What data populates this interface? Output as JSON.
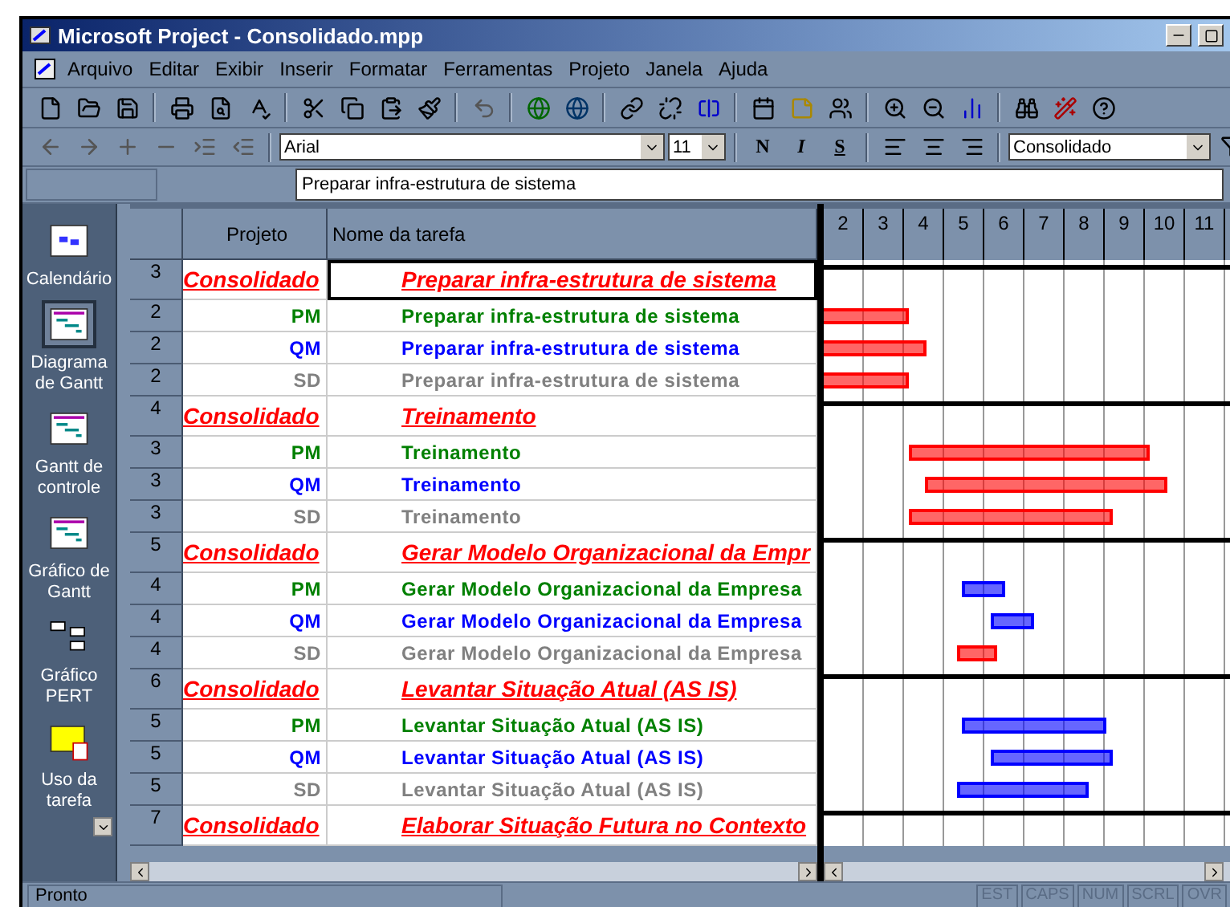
{
  "window": {
    "title": "Microsoft Project - Consolidado.mpp"
  },
  "menu": [
    "Arquivo",
    "Editar",
    "Exibir",
    "Inserir",
    "Formatar",
    "Ferramentas",
    "Projeto",
    "Janela",
    "Ajuda"
  ],
  "format_bar": {
    "font": "Arial",
    "size": "11",
    "bold": "N",
    "italic": "I",
    "underline": "S",
    "filter": "Consolidado"
  },
  "entry_bar": {
    "value": "Preparar infra-estrutura de sistema"
  },
  "view_bar": [
    {
      "label": "Calendário",
      "selected": false
    },
    {
      "label": "Diagrama de Gantt",
      "selected": true
    },
    {
      "label": "Gantt de controle",
      "selected": false
    },
    {
      "label": "Gráfico de Gantt",
      "selected": false
    },
    {
      "label": "Gráfico PERT",
      "selected": false
    },
    {
      "label": "Uso da tarefa",
      "selected": false
    }
  ],
  "table": {
    "columns": [
      "Projeto",
      "Nome da tarefa"
    ],
    "rows": [
      {
        "kind": "summary",
        "id": "3",
        "project": "Consolidado",
        "task": "Preparar infra-estrutura de sistema",
        "selected": true
      },
      {
        "kind": "task",
        "id": "2",
        "project": "PM",
        "task": "Preparar infra-estrutura de sistema",
        "color": "#008000",
        "bar": {
          "color": "#ff0000"
        }
      },
      {
        "kind": "task",
        "id": "2",
        "project": "QM",
        "task": "Preparar infra-estrutura de sistema",
        "color": "#0000ff",
        "bar": {
          "color": "#ff0000"
        }
      },
      {
        "kind": "task",
        "id": "2",
        "project": "SD",
        "task": "Preparar infra-estrutura de sistema",
        "color": "#808080",
        "bar": {
          "color": "#ff0000"
        }
      },
      {
        "kind": "summary",
        "id": "4",
        "project": "Consolidado",
        "task": "Treinamento",
        "selected": false
      },
      {
        "kind": "task",
        "id": "3",
        "project": "PM",
        "task": "Treinamento",
        "color": "#008000",
        "bar": {
          "color": "#ff0000"
        }
      },
      {
        "kind": "task",
        "id": "3",
        "project": "QM",
        "task": "Treinamento",
        "color": "#0000ff",
        "bar": {
          "color": "#ff0000"
        }
      },
      {
        "kind": "task",
        "id": "3",
        "project": "SD",
        "task": "Treinamento",
        "color": "#808080",
        "bar": {
          "color": "#ff0000"
        }
      },
      {
        "kind": "summary",
        "id": "5",
        "project": "Consolidado",
        "task": "Gerar Modelo Organizacional da Empr",
        "selected": false
      },
      {
        "kind": "task",
        "id": "4",
        "project": "PM",
        "task": "Gerar Modelo Organizacional da Empresa",
        "color": "#008000",
        "bar": {
          "color": "#0000ff"
        }
      },
      {
        "kind": "task",
        "id": "4",
        "project": "QM",
        "task": "Gerar Modelo Organizacional da Empresa",
        "color": "#0000ff",
        "bar": {
          "color": "#0000ff"
        }
      },
      {
        "kind": "task",
        "id": "4",
        "project": "SD",
        "task": "Gerar Modelo Organizacional da Empresa",
        "color": "#808080",
        "bar": {
          "color": "#ff0000"
        }
      },
      {
        "kind": "summary",
        "id": "6",
        "project": "Consolidado",
        "task": "Levantar Situação Atual (AS IS)",
        "selected": false
      },
      {
        "kind": "task",
        "id": "5",
        "project": "PM",
        "task": "Levantar Situação Atual (AS IS)",
        "color": "#008000",
        "bar": {
          "color": "#0000ff"
        }
      },
      {
        "kind": "task",
        "id": "5",
        "project": "QM",
        "task": "Levantar Situação Atual (AS IS)",
        "color": "#0000ff",
        "bar": {
          "color": "#0000ff"
        }
      },
      {
        "kind": "task",
        "id": "5",
        "project": "SD",
        "task": "Levantar Situação Atual (AS IS)",
        "color": "#808080",
        "bar": {
          "color": "#0000ff"
        }
      },
      {
        "kind": "summary",
        "id": "7",
        "project": "Consolidado",
        "task": "Elaborar Situação Futura no Contexto",
        "selected": false
      }
    ]
  },
  "timescale": [
    "2",
    "3",
    "4",
    "5",
    "6",
    "7",
    "8",
    "9",
    "10",
    "11"
  ],
  "status_bar": {
    "text": "Pronto",
    "indicators": [
      {
        "label": "EST",
        "on": false
      },
      {
        "label": "CAPS",
        "on": false
      },
      {
        "label": "NUM",
        "on": false
      },
      {
        "label": "SCRL",
        "on": false
      },
      {
        "label": "OVR",
        "on": false
      }
    ]
  }
}
